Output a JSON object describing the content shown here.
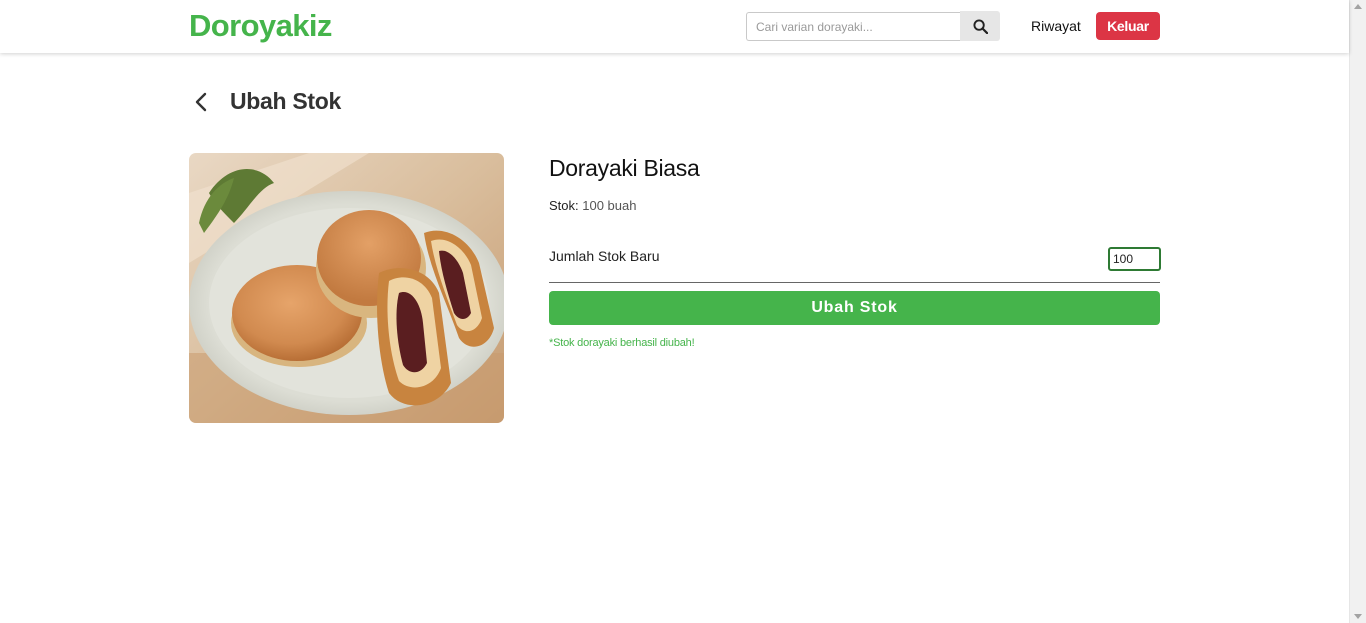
{
  "navbar": {
    "brand": "Doroyakiz",
    "search_placeholder": "Cari varian dorayaki...",
    "history_label": "Riwayat",
    "logout_label": "Keluar"
  },
  "page": {
    "title": "Ubah Stok"
  },
  "product": {
    "name": "Dorayaki Biasa",
    "stock_label": "Stok:",
    "stock_value": "100 buah",
    "new_stock_label": "Jumlah Stok Baru",
    "new_stock_value": "100",
    "submit_label": "Ubah Stok",
    "success_message": "*Stok dorayaki berhasil diubah!"
  },
  "colors": {
    "brand_green": "#45b44b",
    "danger_red": "#dc3545"
  },
  "icons": {
    "search": "search-icon",
    "back": "chevron-left-icon"
  }
}
